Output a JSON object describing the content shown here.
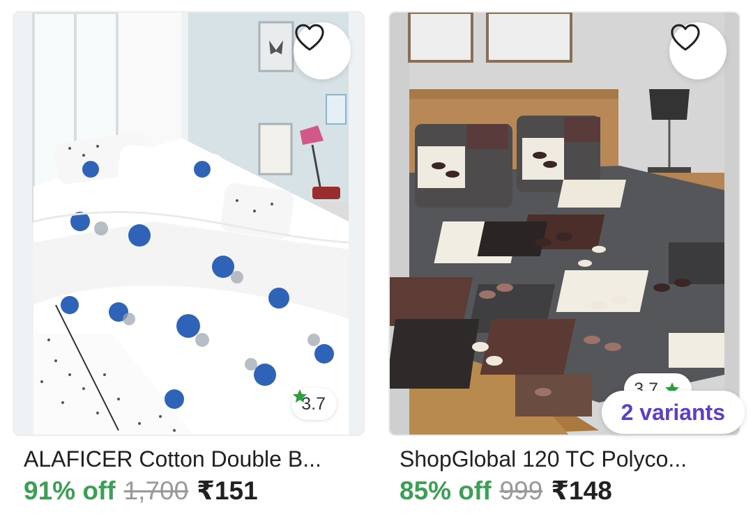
{
  "products": [
    {
      "title": "ALAFICER Cotton Double B...",
      "discount": "91% off",
      "mrp": "1,700",
      "price": "₹151",
      "rating": "3.7",
      "colors": {
        "rating_star": "#2e9e3f",
        "discount": "#3d9f56"
      }
    },
    {
      "title": "ShopGlobal 120 TC Polyco...",
      "discount": "85% off",
      "mrp": "999",
      "price": "₹148",
      "rating": "3.7",
      "variants": "2 variants",
      "colors": {
        "rating_star": "#2e9e3f",
        "variants": "#5b3fc4"
      }
    }
  ],
  "icons": {
    "wishlist": "heart-outline-icon",
    "rating": "star-icon"
  }
}
